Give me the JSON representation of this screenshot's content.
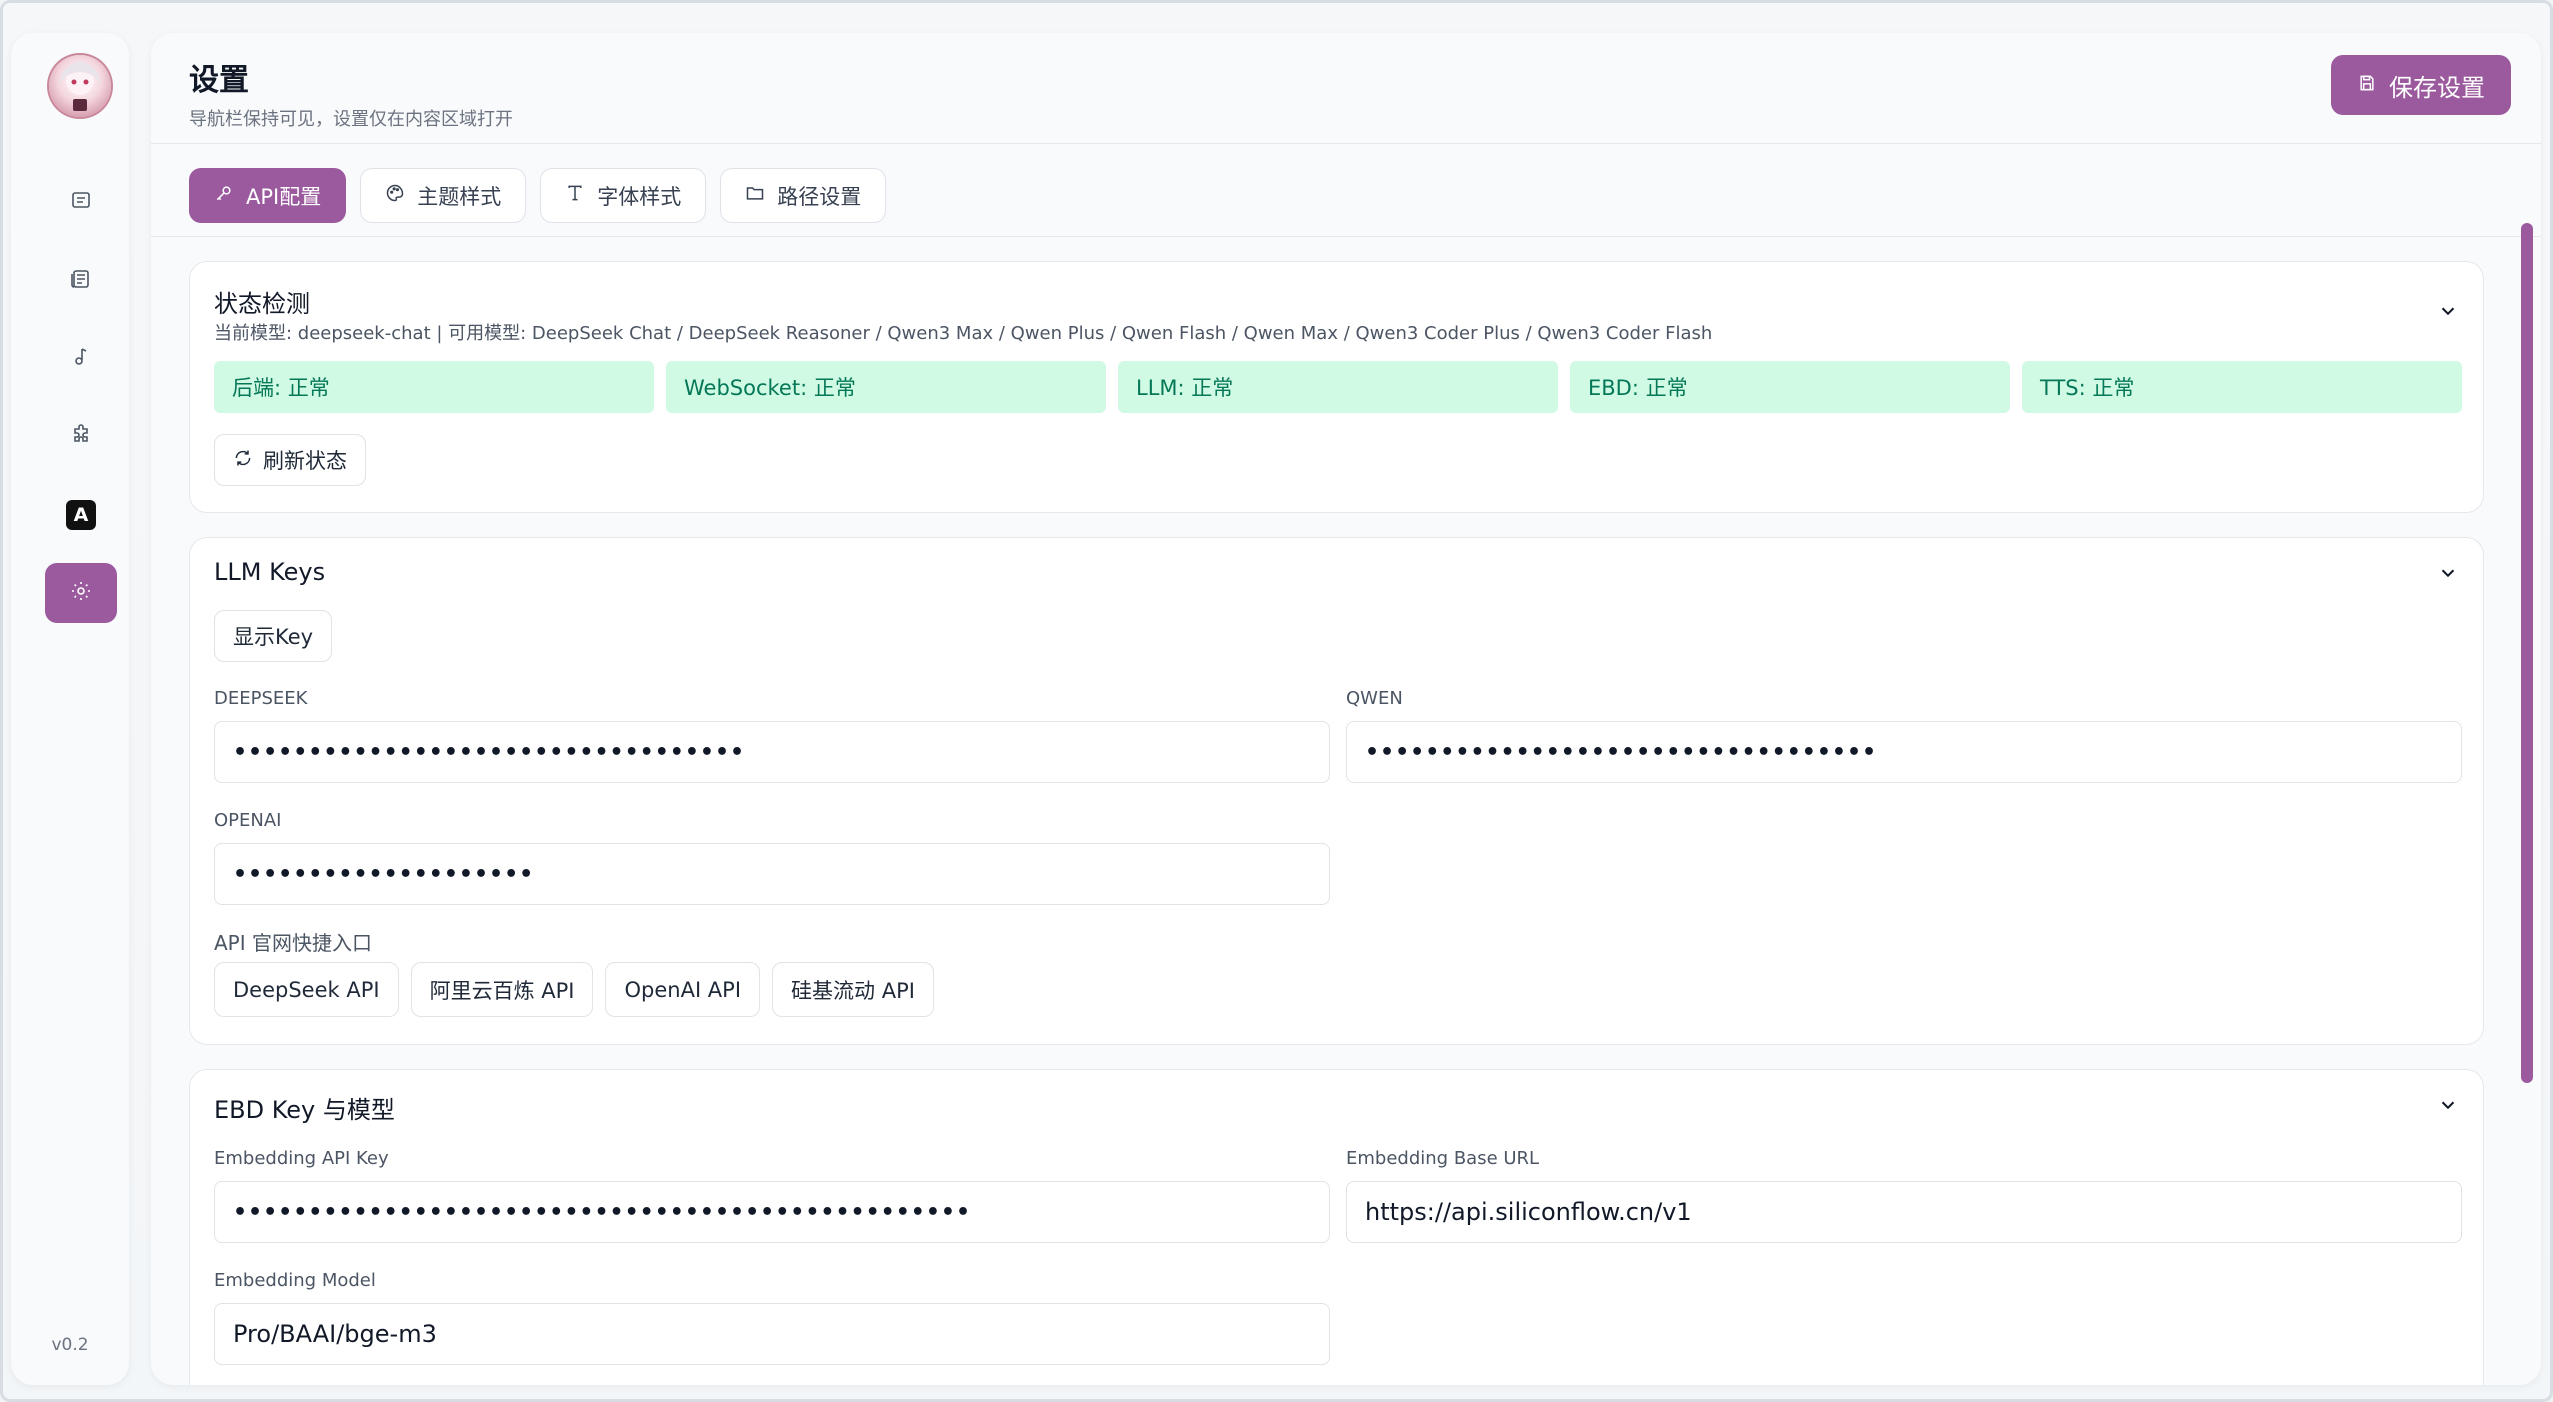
{
  "sidebar": {
    "nav": [
      {
        "icon": "chat-icon"
      },
      {
        "icon": "news-icon"
      },
      {
        "icon": "music-icon"
      },
      {
        "icon": "puzzle-icon"
      },
      {
        "icon": "font-icon",
        "glyph": "A"
      },
      {
        "icon": "gear-icon",
        "active": true
      }
    ],
    "version": "v0.2"
  },
  "header": {
    "title": "设置",
    "subtitle": "导航栏保持可见，设置仅在内容区域打开",
    "save_label": "保存设置"
  },
  "tabs": [
    {
      "label": "API配置",
      "icon": "key-icon",
      "active": true
    },
    {
      "label": "主题样式",
      "icon": "palette-icon"
    },
    {
      "label": "字体样式",
      "icon": "type-icon"
    },
    {
      "label": "路径设置",
      "icon": "folder-icon"
    }
  ],
  "status": {
    "title": "状态检测",
    "subtitle": "当前模型: deepseek-chat | 可用模型: DeepSeek Chat / DeepSeek Reasoner / Qwen3 Max / Qwen Plus / Qwen Flash / Qwen Max / Qwen3 Coder Plus / Qwen3 Coder Flash",
    "items": [
      "后端: 正常",
      "WebSocket: 正常",
      "LLM: 正常",
      "EBD: 正常",
      "TTS: 正常"
    ],
    "refresh_label": "刷新状态"
  },
  "llm_keys": {
    "title": "LLM Keys",
    "show_key_label": "显示Key",
    "deepseek_label": "DEEPSEEK",
    "deepseek_value": "••••••••••••••••••••••••••••••••••",
    "qwen_label": "QWEN",
    "qwen_value": "••••••••••••••••••••••••••••••••••",
    "openai_label": "OPENAI",
    "openai_value": "••••••••••••••••••••",
    "links_label": "API 官网快捷入口",
    "links": [
      "DeepSeek API",
      "阿里云百炼 API",
      "OpenAI API",
      "硅基流动 API"
    ]
  },
  "ebd": {
    "title": "EBD Key 与模型",
    "api_key_label": "Embedding API Key",
    "api_key_value": "•••••••••••••••••••••••••••••••••••••••••••••••••",
    "base_url_label": "Embedding Base URL",
    "base_url_value": "https://api.siliconflow.cn/v1",
    "model_label": "Embedding Model",
    "model_value": "Pro/BAAI/bge-m3"
  },
  "colors": {
    "accent": "#9b5a9e",
    "status_bg": "#d1fae5",
    "status_text": "#047857"
  }
}
